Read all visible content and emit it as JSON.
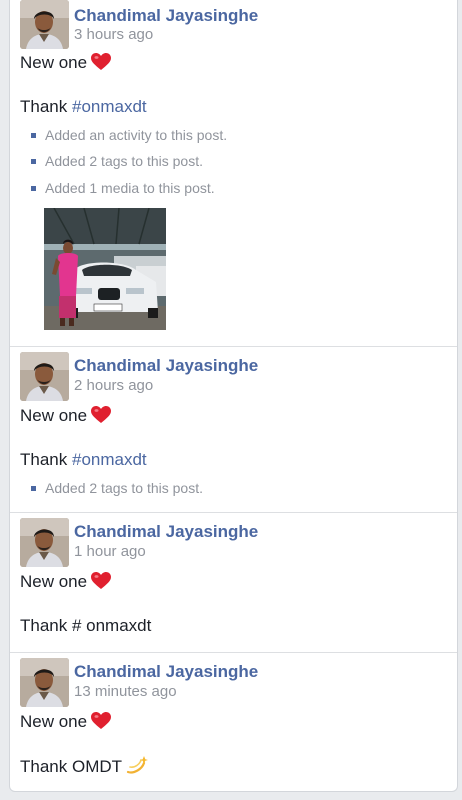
{
  "posts": [
    {
      "author": "Chandimal Jayasinghe",
      "time": "3 hours ago",
      "line1": "New one",
      "line2_prefix": "Thank ",
      "hashtag": "#onmaxdt",
      "activities": [
        "Added an activity to this post.",
        "Added 2 tags to this post.",
        "Added 1 media to this post."
      ],
      "media": {
        "plate": "CBB 2020"
      }
    },
    {
      "author": "Chandimal Jayasinghe",
      "time": "2 hours ago",
      "line1": "New one",
      "line2_prefix": "Thank ",
      "hashtag": "#onmaxdt",
      "activities": [
        "Added 2 tags to this post."
      ]
    },
    {
      "author": "Chandimal Jayasinghe",
      "time": "1 hour ago",
      "line1": "New one",
      "line2": "Thank # onmaxdt"
    },
    {
      "author": "Chandimal Jayasinghe",
      "time": "13 minutes ago",
      "line1": "New one",
      "line2": "Thank OMDT"
    }
  ],
  "icons": {
    "heart": "heart-emoji-icon",
    "dizzy": "dizzy-emoji-icon",
    "bullet": "square-bullet-icon"
  },
  "colors": {
    "link": "#4b67a1",
    "meta": "#90949c",
    "text": "#1d2129",
    "heart": "#e0202f",
    "page_bg": "#e9ebee"
  }
}
